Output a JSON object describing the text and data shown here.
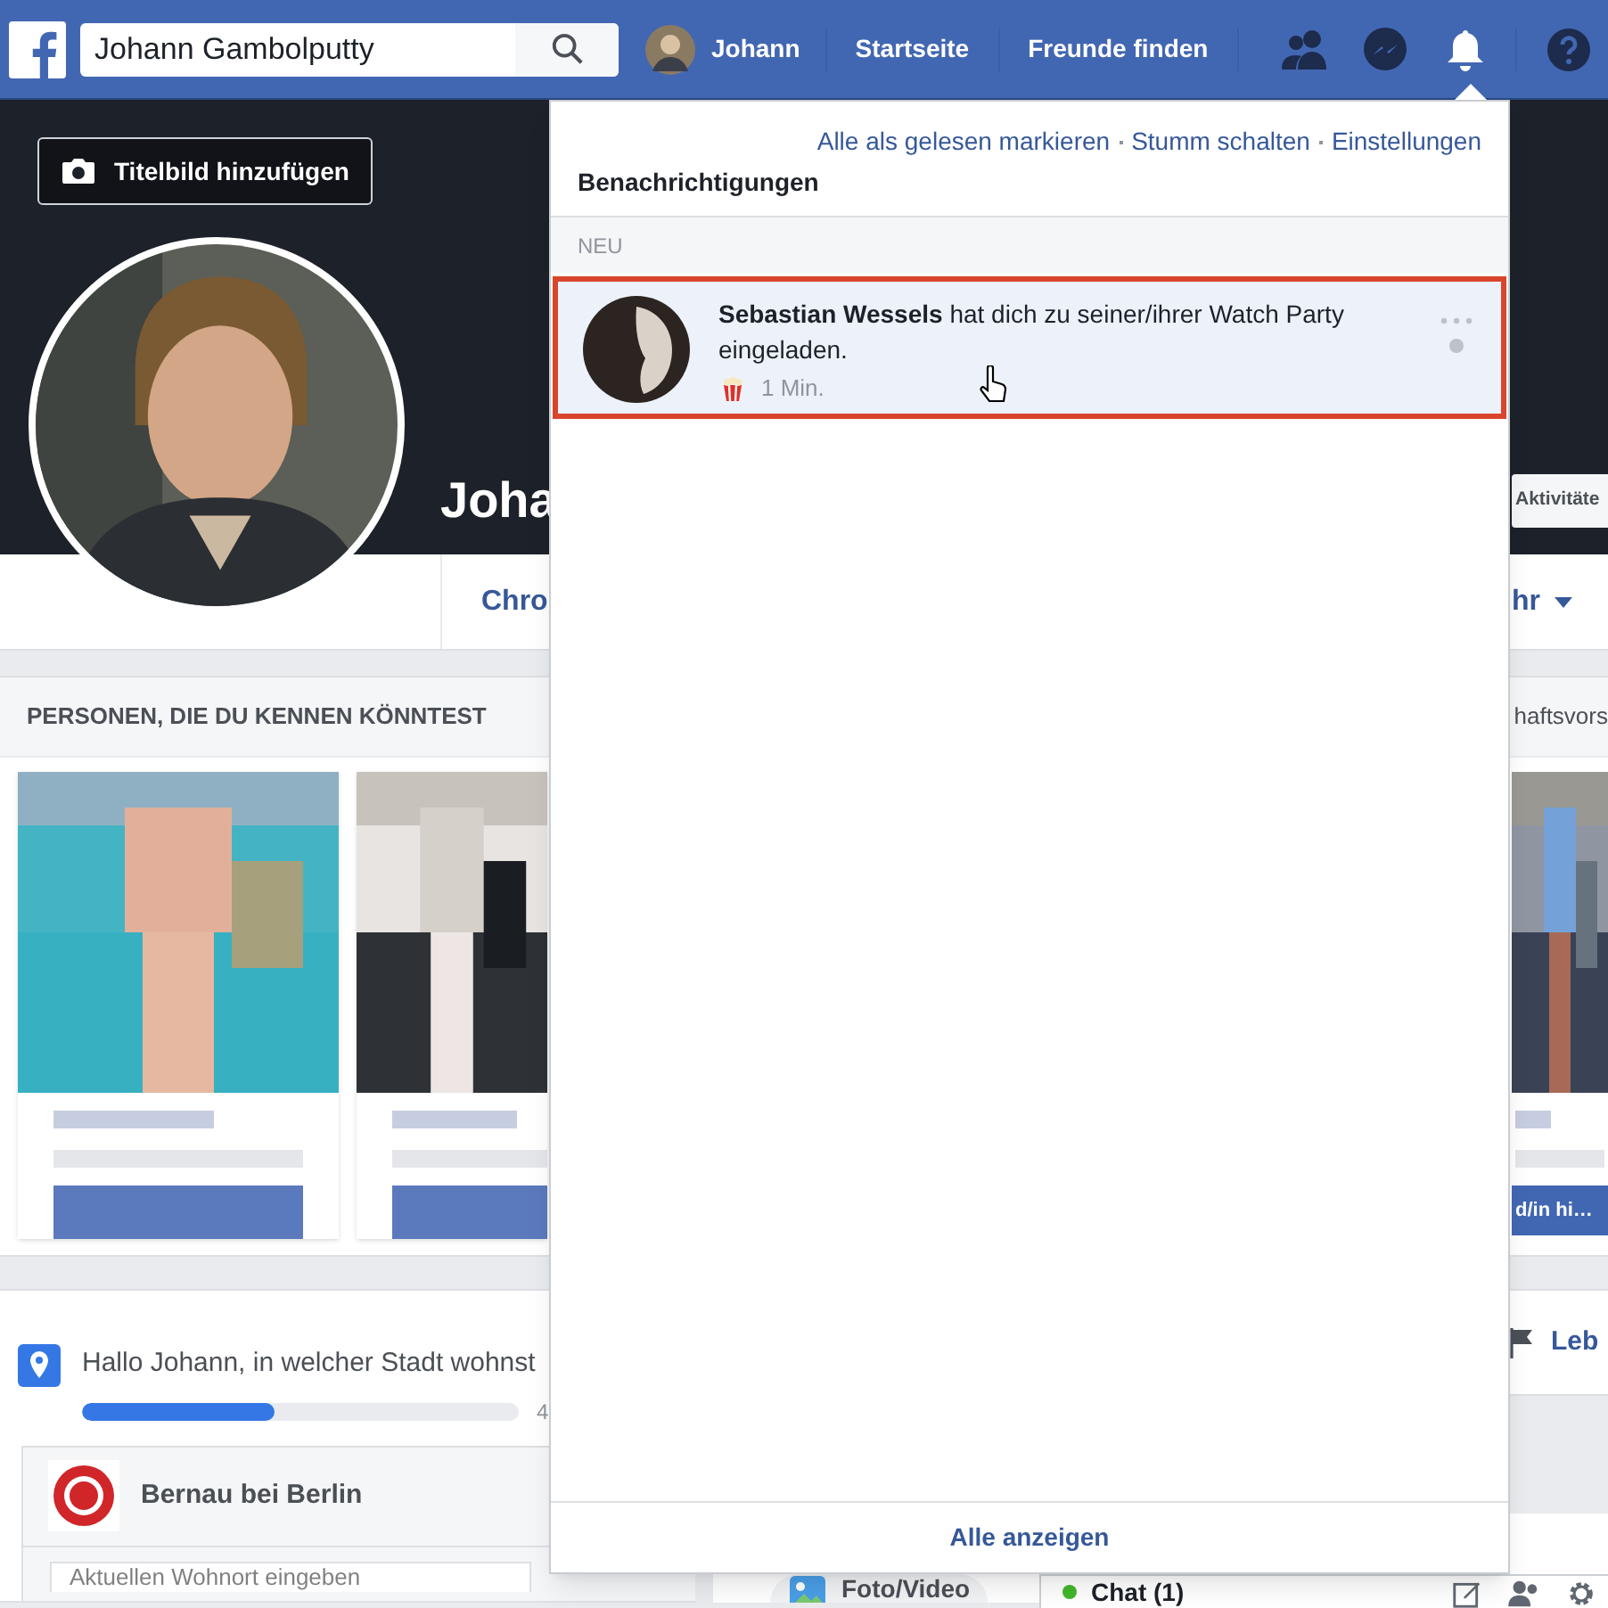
{
  "topbar": {
    "search": {
      "value": "Johann Gambolputty"
    },
    "profile_name": "Johann",
    "nav_links": [
      {
        "label": "Startseite"
      },
      {
        "label": "Freunde finden"
      }
    ],
    "icons": [
      {
        "kind": "friends",
        "selected": false
      },
      {
        "kind": "messenger",
        "selected": false
      },
      {
        "kind": "notifications",
        "selected": true
      },
      {
        "kind": "help",
        "selected": false
      }
    ]
  },
  "cover": {
    "add_cover_button": "Titelbild hinzufügen",
    "name": "Joha",
    "activity_button": "Aktivitäte"
  },
  "profile_nav": {
    "tabs": [
      {
        "label": "Chro"
      },
      {
        "label": "hr"
      }
    ]
  },
  "people_card": {
    "title": "PERSONEN, DIE DU KENNEN KÖNNTEST",
    "right_link": "haftsvors",
    "right_button": "d/in hi…"
  },
  "location_card": {
    "question": "Hallo Johann, in welcher Stadt wohnst",
    "progress": {
      "level": 0.44,
      "reading": "4"
    },
    "place": "Bernau bei Berlin",
    "input": {
      "placeholder": "Aktuellen Wohnort eingeben"
    }
  },
  "right_column": {
    "life_event": "Leb"
  },
  "composer": {
    "photo_video": "Foto/Video"
  },
  "chat": {
    "label": "Chat (1)",
    "online": true
  },
  "notifications": {
    "actions": [
      "Alle als gelesen markieren",
      "Stumm schalten",
      "Einstellungen"
    ],
    "title": "Benachrichtigungen",
    "section": "NEU",
    "items": [
      {
        "text": "**Sebastian Wessels** hat dich zu seiner/ihrer Watch Party eingeladen.",
        "time": "1 Min.",
        "unread": true,
        "highlighted": true
      }
    ],
    "footer": "Alle anzeigen"
  }
}
